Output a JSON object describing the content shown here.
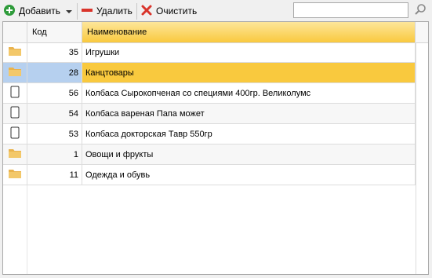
{
  "toolbar": {
    "add_label": "Добавить",
    "delete_label": "Удалить",
    "clear_label": "Очистить",
    "search_value": "",
    "colors": {
      "add_icon": "#2e9b3a",
      "delete_icon": "#d9342b",
      "clear_icon": "#d9342b"
    }
  },
  "grid": {
    "columns": {
      "icon": "",
      "code": "Код",
      "name": "Наименование"
    },
    "rows": [
      {
        "icon": "folder-icon",
        "code": "35",
        "name": "Игрушки"
      },
      {
        "icon": "folder-icon",
        "code": "28",
        "name": "Канцтовары",
        "selected": true
      },
      {
        "icon": "document-icon",
        "code": "56",
        "name": "Колбаса  Сырокопченая со  специями 400гр.  Великолумс"
      },
      {
        "icon": "document-icon",
        "code": "54",
        "name": "Колбаса вареная Папа может"
      },
      {
        "icon": "document-icon",
        "code": "53",
        "name": "Колбаса докторская Тавр 550гр"
      },
      {
        "icon": "folder-icon",
        "code": "1",
        "name": "Овощи и фрукты"
      },
      {
        "icon": "folder-icon",
        "code": "11",
        "name": "Одежда и обувь"
      }
    ],
    "colors": {
      "selected_name": "#f9c93e",
      "selected_row": "#b6d0ef",
      "header_active": "#f9c93e",
      "folder": "#e9b34e"
    }
  }
}
